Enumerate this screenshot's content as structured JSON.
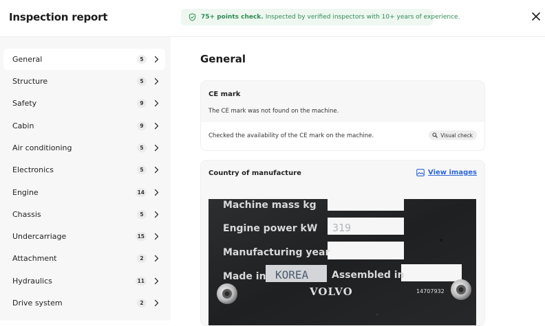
{
  "header": {
    "title": "Inspection report",
    "banner_strong": "75+ points check.",
    "banner_text": "Inspected by verified inspectors with 10+ years of experience."
  },
  "sidebar": {
    "items": [
      {
        "label": "General",
        "count": "5",
        "active": true
      },
      {
        "label": "Structure",
        "count": "5"
      },
      {
        "label": "Safety",
        "count": "9"
      },
      {
        "label": "Cabin",
        "count": "9"
      },
      {
        "label": "Air conditioning",
        "count": "5"
      },
      {
        "label": "Electronics",
        "count": "5"
      },
      {
        "label": "Engine",
        "count": "14"
      },
      {
        "label": "Chassis",
        "count": "5"
      },
      {
        "label": "Undercarriage",
        "count": "15"
      },
      {
        "label": "Attachment",
        "count": "2"
      },
      {
        "label": "Hydraulics",
        "count": "11"
      },
      {
        "label": "Drive system",
        "count": "2"
      }
    ]
  },
  "main": {
    "title": "General",
    "ce_card": {
      "title": "CE mark",
      "description": "The CE mark was not found on the machine.",
      "check_text": "Checked the availability of the CE mark on the machine.",
      "badge": "Visual check"
    },
    "country_card": {
      "title": "Country of manufacture",
      "view_images": "View images",
      "plate": {
        "mass_label": "Machine mass kg",
        "power_label": "Engine power kW",
        "power_value": "319",
        "year_label": "Manufacturing year",
        "made_in_label": "Made in",
        "made_in_value": "KOREA",
        "assembled_label": "Assembled in",
        "brand": "VOLVO",
        "serial": "14707932"
      }
    }
  },
  "colors": {
    "accent_green": "#2f8a52",
    "banner_bg": "#eef8f1",
    "link_blue": "#2e66d8",
    "sidebar_bg": "#f7f7f7"
  }
}
